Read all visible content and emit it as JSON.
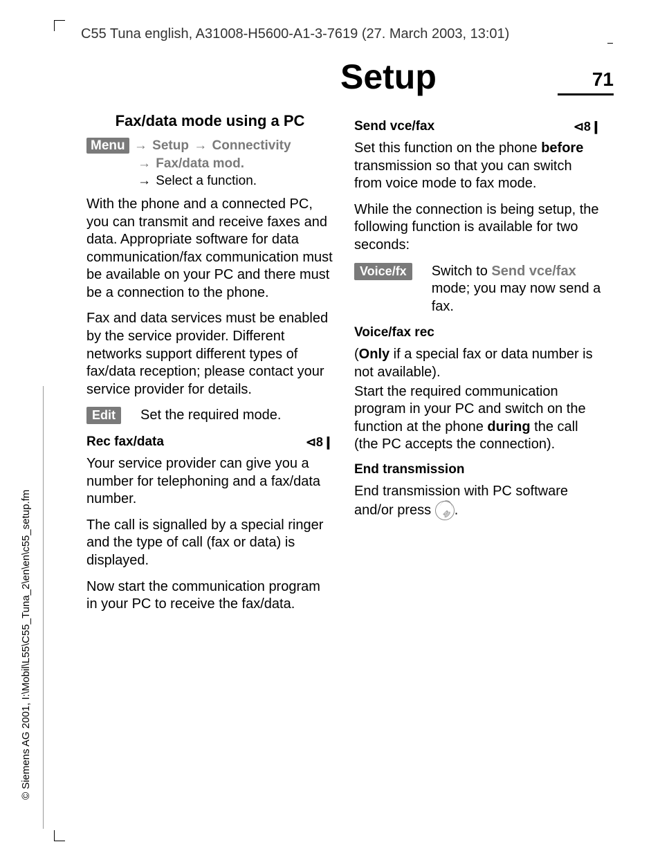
{
  "header": "C55 Tuna english, A31008-H5600-A1-3-7619 (27. March 2003, 13:01)",
  "title": "Setup",
  "page": "71",
  "left": {
    "h": "Fax/data mode using a PC",
    "menu": {
      "label": "Menu",
      "p1": "Setup",
      "p2": "Connectivity",
      "p3": "Fax/data mod.",
      "p4": "Select a function."
    },
    "para1": "With the phone and a connected PC, you can transmit and receive faxes and data. Appropriate software for data communication/fax communication must be available on your PC and there must be a connection to the phone.",
    "para2": "Fax and data services must be enabled by the service provider. Different networks support different types of fax/data reception; please contact your service provider for details.",
    "edit_key": "Edit",
    "edit_text": "Set the required mode.",
    "sub1": "Rec fax/data",
    "para3": "Your service provider can give you a number for telephoning and a fax/data number.",
    "para4": "The call is signalled by a special ringer and the type of call (fax or data) is displayed.",
    "para5": "Now start the communication program in your PC to receive the fax/data."
  },
  "right": {
    "sub1": "Send vce/fax",
    "para1a": "Set this function on the phone ",
    "para1b": "before",
    "para1c": " transmission so that you can switch from voice mode to fax mode.",
    "para2": "While the connection is being setup, the following function is available for two seconds:",
    "vf_key": "Voice/fx",
    "vf_text_a": "Switch to ",
    "vf_text_b": "Send vce/fax",
    "vf_text_c": " mode; you may now send a fax.",
    "sub2": "Voice/fax rec",
    "para3a": "(",
    "para3b": "Only",
    "para3c": " if a special fax or data number is not available).",
    "para4a": "Start the required communication program in your PC and switch on the function at the phone ",
    "para4b": "during",
    "para4c": " the call (the PC accepts the connection).",
    "sub3": "End transmission",
    "para5a": "End transmission with PC software and/or press ",
    "para5b": "."
  },
  "side": "© Siemens AG 2001, I:\\Mobil\\L55\\C55_Tuna_2\\en\\en\\c55_setup.fm",
  "icons": {
    "provider": "⊲8❙"
  }
}
